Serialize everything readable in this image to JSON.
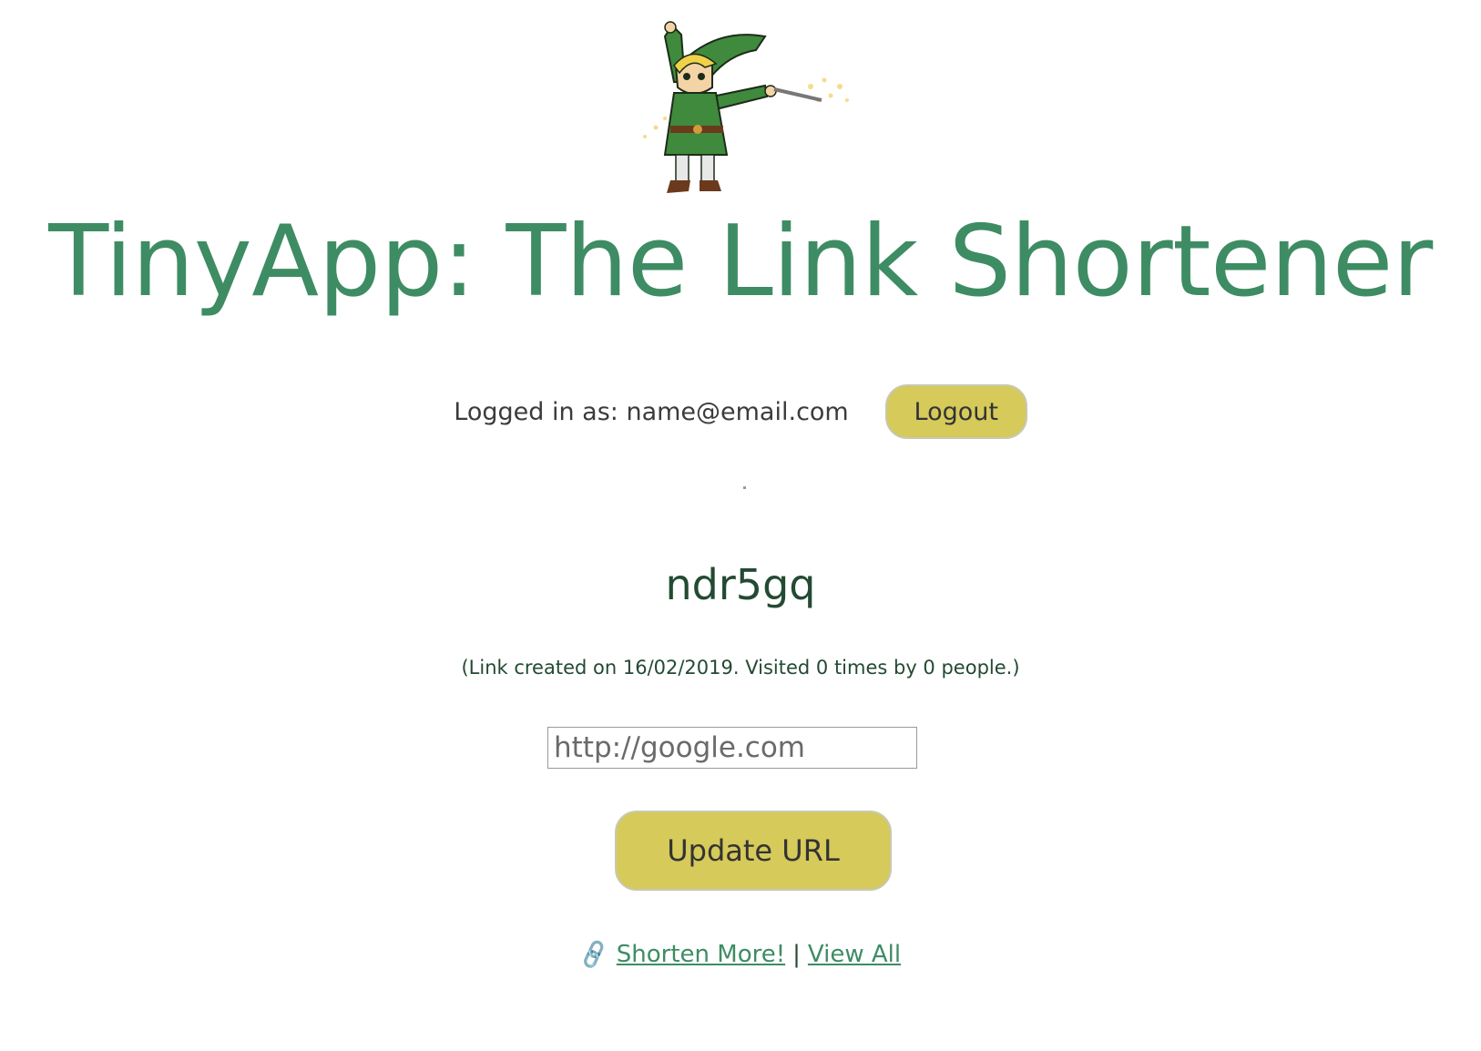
{
  "header": {
    "title": "TinyApp: The Link Shortener",
    "mascot_icon": "elf-hero-mascot"
  },
  "login": {
    "text": "Logged in as: name@email.com",
    "logout_label": "Logout"
  },
  "link": {
    "short_code": "ndr5gq",
    "meta": "(Link created on 16/02/2019. Visited 0 times by 0 people.)"
  },
  "form": {
    "url_placeholder": "http://google.com",
    "update_label": "Update URL"
  },
  "footer": {
    "link_icon": "link-chain-icon",
    "shorten_more_label": "Shorten More!",
    "separator": "|",
    "view_all_label": "View All"
  },
  "colors": {
    "title": "#3e8c64",
    "button": "#d5ca5a",
    "dark_green": "#234a32"
  }
}
